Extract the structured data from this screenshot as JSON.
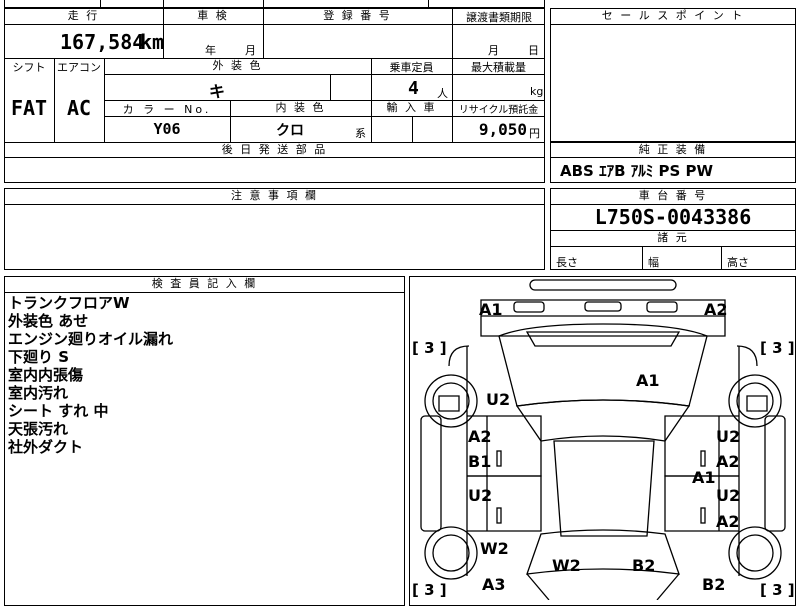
{
  "main_table": {
    "mileage_header": "走 行",
    "mileage_value": "167,584",
    "mileage_unit": "km",
    "inspection_header": "車 検",
    "inspection_year": "年",
    "inspection_month": "月",
    "registration_header": "登 録 番 号",
    "transfer_header": "譲渡書類期限",
    "transfer_month": "月",
    "transfer_day": "日",
    "shift_header": "シフト",
    "ac_header": "エアコン",
    "exterior_header": "外 装 色",
    "exterior_value": "キ",
    "capacity_header": "乗車定員",
    "capacity_value": "4",
    "capacity_unit": "人",
    "maxload_header": "最大積載量",
    "maxload_unit": "kg",
    "shift_value": "FAT",
    "ac_value": "AC",
    "colorno_header": "カ ラ ー No.",
    "colorno_value": "Y06",
    "interior_header": "内 装 色",
    "interior_value": "クロ",
    "interior_suffix": "系",
    "import_header": "輸 入 車",
    "recycle_header": "リサイクル預託金",
    "recycle_value": "9,050",
    "recycle_unit": "円",
    "later_parts_header": "後 日 発 送 部 品"
  },
  "sales_point": {
    "header": "セ ー ル ス ポ イ ン ト"
  },
  "equipment": {
    "header": "純 正 装 備",
    "value": "ABS ｴｱB ｱﾙﾐ PS PW"
  },
  "notes": {
    "header": "注 意 事 項 欄"
  },
  "chassis": {
    "header": "車 台 番 号",
    "value": "L750S-0043386"
  },
  "dimensions": {
    "header": "諸 元",
    "length": "長さ",
    "width": "幅",
    "height": "高さ"
  },
  "inspector": {
    "header": "検 査 員 記 入 欄",
    "lines": [
      "トランクフロアW",
      "外装色 あせ",
      "エンジン廻りオイル漏れ",
      "下廻り S",
      "室内内張傷",
      "室内汚れ",
      "シート すれ 中",
      "天張汚れ",
      "社外ダクト"
    ]
  },
  "diagram": {
    "codes": {
      "a1_front_left": "A1",
      "a2_front_right": "A2",
      "tire_fl": "[ 3 ]",
      "tire_fr": "[ 3 ]",
      "a1_hood": "A1",
      "u2_left_fender": "U2",
      "a2_left_door_top": "A2",
      "b1_left_door": "B1",
      "u2_left_rear": "U2",
      "w2_left_quarter": "W2",
      "a3_rear_left": "A3",
      "w2_trunk": "W2",
      "b2_trunk": "B2",
      "b2_rear_right": "B2",
      "u2_right_door": "U2",
      "a2_right_door": "A2",
      "a1_right_door": "A1",
      "u2_right_rear": "U2",
      "a2_right_rear": "A2",
      "tire_rl": "[ 3 ]",
      "tire_rr": "[ 3 ]"
    }
  }
}
